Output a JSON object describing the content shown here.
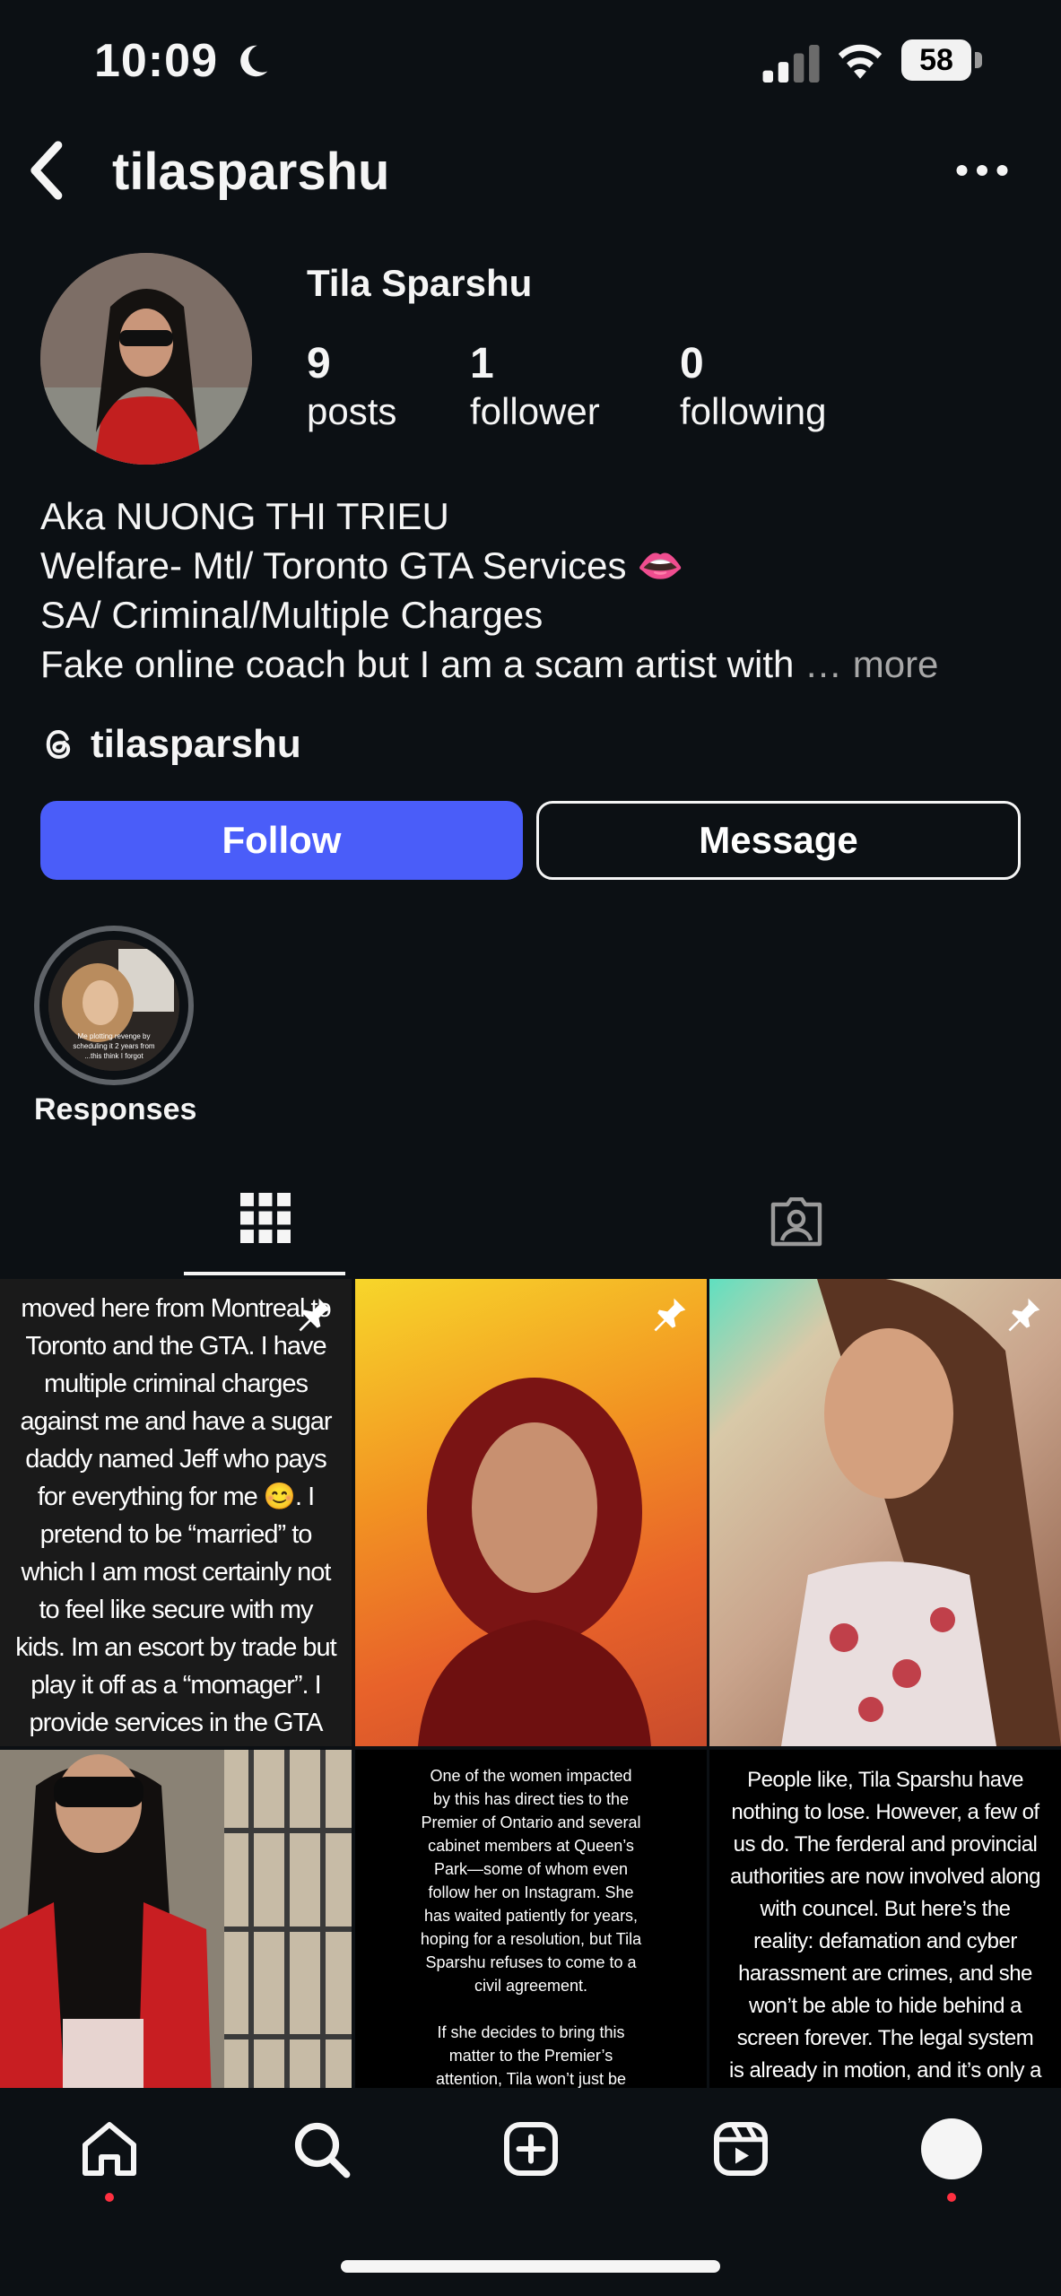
{
  "status_bar": {
    "time": "10:09",
    "battery": "58"
  },
  "header": {
    "username": "tilasparshu"
  },
  "profile": {
    "display_name": "Tila Sparshu",
    "stats": [
      {
        "value": "9",
        "label": "posts"
      },
      {
        "value": "1",
        "label": "follower"
      },
      {
        "value": "0",
        "label": "following"
      }
    ],
    "bio": [
      "Aka NUONG THI TRIEU",
      "Welfare- Mtl/ Toronto GTA Services 👄",
      "SA/ Criminal/Multiple Charges",
      "Fake online coach but I am a scam artist with"
    ],
    "bio_ellipsis": "…",
    "bio_more": "more",
    "threads_handle": "tilasparshu"
  },
  "actions": {
    "follow": "Follow",
    "message": "Message"
  },
  "highlights": [
    {
      "label": "Responses",
      "img_text_1": "Me plotting revenge by",
      "img_text_2": "scheduling it 2 years from",
      "img_text_3": "...this think I forgot"
    }
  ],
  "posts": {
    "p1_text": "moved here from Montreal to Toronto and the GTA. I have multiple criminal charges against me and have a sugar daddy named Jeff who pays for everything for me 😊. I pretend to be “married” to which I am most certainly not to feel like secure with my kids. Im an escort by trade but play it off as a “momager”.  I provide services in the GTA 👄",
    "p5_text_1": "One of the women impacted by this has direct ties to the Premier of Ontario and several cabinet members at Queen’s Park—some of whom even follow her on Instagram. She has waited patiently for years, hoping for a resolution, but Tila Sparshu refuses to come to a civil agreement.",
    "p5_text_2": "If she decides to bring this matter to the Premier’s attention, Tila won’t just be facing criminal",
    "p6_text": "People like, Tila Sparshu have nothing to lose. However, a few of us do. The ferderal and provincial authorities are now involved along with councel. But here’s the reality: defamation and cyber harassment are crimes, and she won’t be able to hide behind a screen forever. The legal system is already in motion, and it’s only a"
  },
  "colors": {
    "background": "#0c1014",
    "follow_button": "#4a5df9",
    "notification_dot": "#ff3040"
  }
}
